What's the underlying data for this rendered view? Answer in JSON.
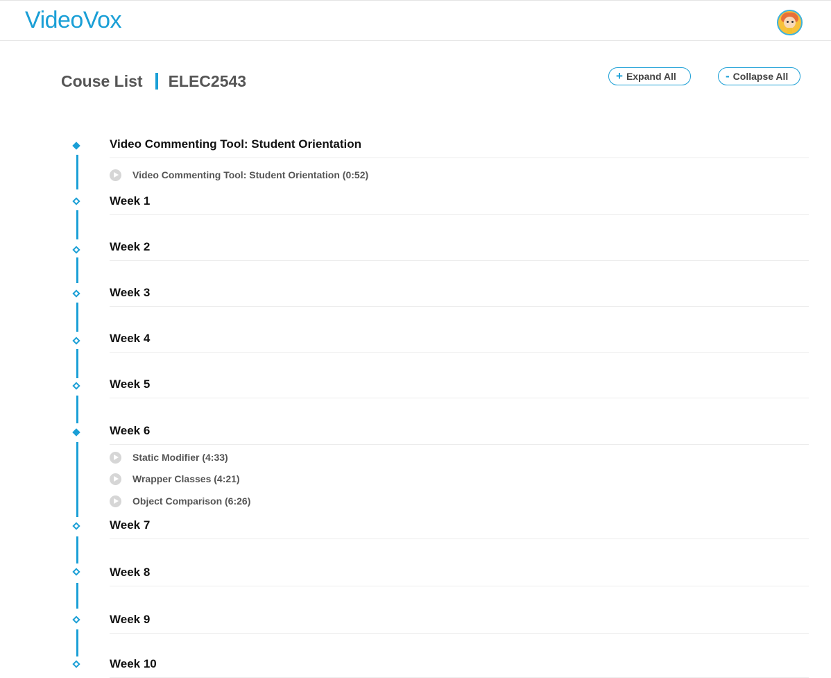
{
  "header": {
    "logo": "VideoVox",
    "avatar_icon": "user-avatar-icon"
  },
  "title": {
    "label": "Couse List",
    "course": "ELEC2543"
  },
  "toolbar": {
    "expand_label": "Expand All",
    "expand_symbol": "+",
    "collapse_label": "Collapse All",
    "collapse_symbol": "-"
  },
  "colors": {
    "accent": "#1a9fd6",
    "play_icon": "#d6d6d6"
  },
  "sections": [
    {
      "title": "Video Commenting Tool: Student Orientation",
      "expanded": true,
      "videos": [
        "Video Commenting Tool: Student Orientation (0:52)"
      ]
    },
    {
      "title": "Week 1",
      "expanded": false,
      "videos": []
    },
    {
      "title": "Week 2",
      "expanded": false,
      "videos": []
    },
    {
      "title": "Week 3",
      "expanded": false,
      "videos": []
    },
    {
      "title": "Week 4",
      "expanded": false,
      "videos": []
    },
    {
      "title": "Week 5",
      "expanded": false,
      "videos": []
    },
    {
      "title": "Week 6",
      "expanded": true,
      "videos": [
        "Static Modifier (4:33)",
        "Wrapper Classes (4:21)",
        "Object Comparison (6:26)"
      ]
    },
    {
      "title": "Week 7",
      "expanded": false,
      "videos": []
    },
    {
      "title": "Week 8",
      "expanded": false,
      "videos": []
    },
    {
      "title": "Week 9",
      "expanded": false,
      "videos": []
    },
    {
      "title": "Week 10",
      "expanded": false,
      "videos": []
    }
  ]
}
